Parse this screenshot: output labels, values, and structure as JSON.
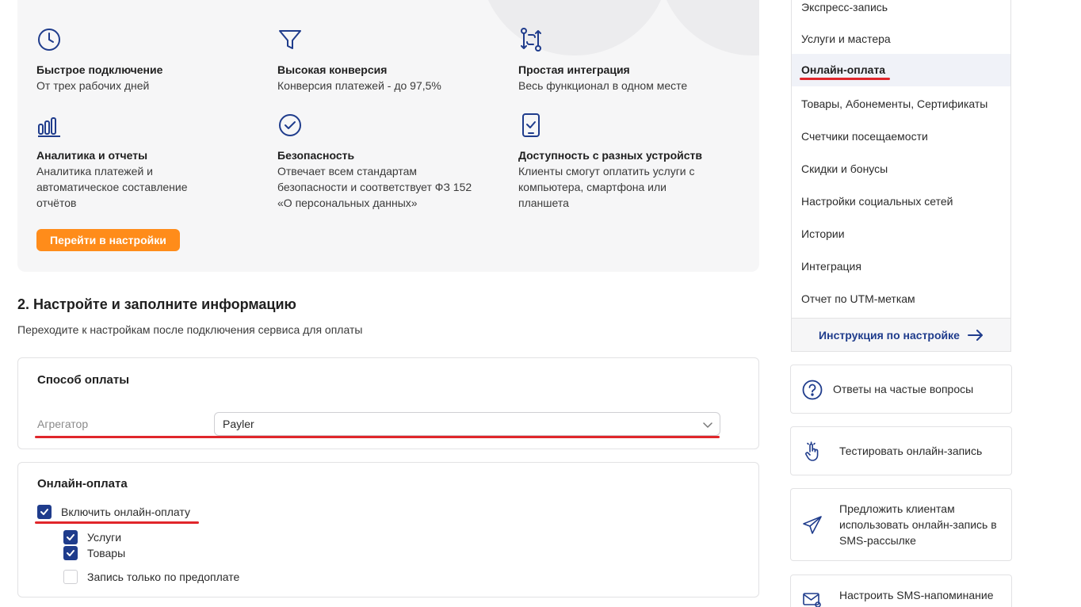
{
  "features": [
    {
      "icon": "clock-icon",
      "title": "Быстрое подключение",
      "desc": "От трех рабочих дней"
    },
    {
      "icon": "funnel-icon",
      "title": "Высокая конверсия",
      "desc": "Конверсия платежей - до 97,5%"
    },
    {
      "icon": "integration-icon",
      "title": "Простая интеграция",
      "desc": "Весь функционал в одном месте"
    },
    {
      "icon": "bar-chart-icon",
      "title": "Аналитика и отчеты",
      "desc": "Аналитика платежей и автоматическое составление отчётов"
    },
    {
      "icon": "check-circle-icon",
      "title": "Безопасность",
      "desc": "Отвечает всем стандартам безопасности и соответствует ФЗ 152 «О персональных данных»"
    },
    {
      "icon": "device-check-icon",
      "title": "Доступность с разных устройств",
      "desc": "Клиенты смогут оплатить услуги с компьютера, смартфона или планшета"
    }
  ],
  "go_settings_label": "Перейти в настройки",
  "section": {
    "title": "2. Настройте и заполните информацию",
    "subtitle": "Переходите к настройкам после подключения сервиса для оплаты"
  },
  "payment_method": {
    "title": "Способ оплаты",
    "aggregator_label": "Агрегатор",
    "aggregator_value": "Payler"
  },
  "online_payment": {
    "title": "Онлайн-оплата",
    "enable_label": "Включить онлайн-оплату",
    "enable_checked": true,
    "options": [
      {
        "label": "Услуги",
        "checked": true
      },
      {
        "label": "Товары",
        "checked": true
      },
      {
        "label": "Запись только по предоплате",
        "checked": false
      }
    ]
  },
  "sidebar": {
    "items": [
      {
        "label": "Экспресс-запись"
      },
      {
        "label": "Услуги и мастера"
      },
      {
        "label": "Онлайн-оплата",
        "active": true
      },
      {
        "label": "Товары, Абонементы, Сертификаты"
      },
      {
        "label": "Счетчики посещаемости"
      },
      {
        "label": "Скидки и бонусы"
      },
      {
        "label": "Настройки социальных сетей"
      },
      {
        "label": "Истории"
      },
      {
        "label": "Интеграция"
      },
      {
        "label": "Отчет по UTM-меткам"
      }
    ],
    "instruction_label": "Инструкция по настройке"
  },
  "side_cards": [
    {
      "icon": "question-circle-icon",
      "text": "Ответы на частые вопросы"
    },
    {
      "icon": "tap-hand-icon",
      "text": "Тестировать онлайн-запись"
    },
    {
      "icon": "paper-plane-icon",
      "text": "Предложить клиентам использовать онлайн-запись в SMS-рассылке"
    },
    {
      "icon": "envelope-gear-icon",
      "text": "Настроить SMS-напоминание с подтверждением записи"
    }
  ],
  "colors": {
    "accent": "#1f3c8c",
    "button_orange": "#ff8c1a",
    "highlight_red": "#e0262b"
  }
}
